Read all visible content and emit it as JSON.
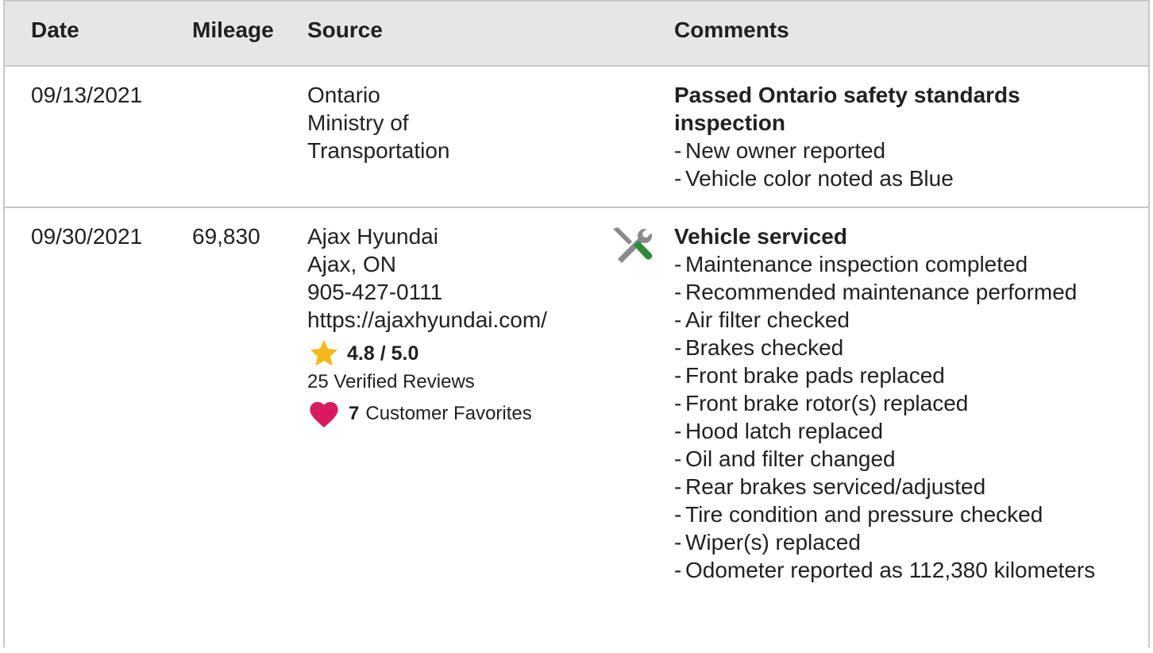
{
  "header": {
    "date": "Date",
    "mileage": "Mileage",
    "source": "Source",
    "comments": "Comments"
  },
  "records": [
    {
      "date": "09/13/2021",
      "mileage": "",
      "source": [
        "Ontario",
        "Ministry of",
        "Transportation"
      ],
      "comment_title": "Passed Ontario safety standards inspection",
      "comments": [
        "New owner reported",
        "Vehicle color noted as Blue"
      ]
    },
    {
      "date": "09/30/2021",
      "mileage": "69,830",
      "source": [
        "Ajax Hyundai",
        "Ajax, ON",
        "905-427-0111",
        "https://ajaxhyundai.com/"
      ],
      "rating": "4.8 / 5.0",
      "reviews": "25 Verified Reviews",
      "favorites_count": "7",
      "favorites_label": "Customer Favorites",
      "icon": "service-tools-icon",
      "comment_title": "Vehicle serviced",
      "comments": [
        "Maintenance inspection completed",
        "Recommended maintenance performed",
        "Air filter checked",
        "Brakes checked",
        "Front brake pads replaced",
        "Front brake rotor(s) replaced",
        "Hood latch replaced",
        "Oil and filter changed",
        "Rear brakes serviced/adjusted",
        "Tire condition and pressure checked",
        "Wiper(s) replaced",
        "Odometer reported as 112,380 kilometers"
      ]
    }
  ],
  "colors": {
    "header_bg": "#e6e6e6",
    "border": "#c8c8c8",
    "star": "#f5b81c",
    "heart": "#d81b60",
    "tool_grey": "#8a8a8a",
    "tool_green": "#2e8b3a"
  },
  "icons": {
    "star": "star-icon",
    "heart": "heart-icon",
    "tools": "service-tools-icon"
  }
}
